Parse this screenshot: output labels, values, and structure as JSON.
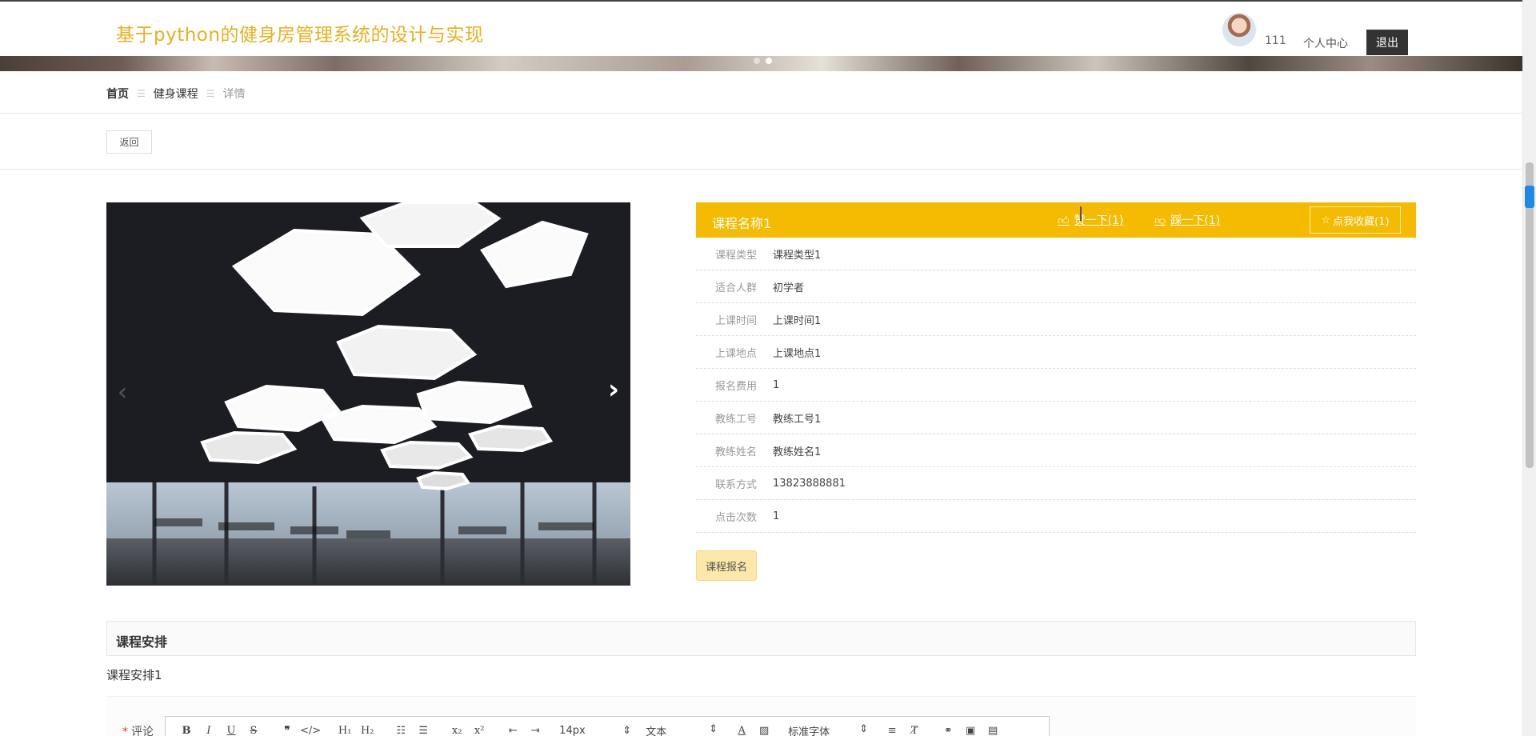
{
  "header": {
    "site_title": "基于python的健身房管理系统的设计与实现",
    "username": "111",
    "user_center": "个人中心",
    "logout": "退出"
  },
  "breadcrumb": {
    "home": "首页",
    "category": "健身课程",
    "current": "详情"
  },
  "actions": {
    "back": "返回"
  },
  "course": {
    "name": "课程名称1",
    "like_label": "赞一下(1)",
    "dislike_label": "踩一下(1)",
    "favorite_label": "点我收藏(1)",
    "fields": [
      {
        "label": "课程类型",
        "value": "课程类型1"
      },
      {
        "label": "适合人群",
        "value": "初学者"
      },
      {
        "label": "上课时间",
        "value": "上课时间1"
      },
      {
        "label": "上课地点",
        "value": "上课地点1"
      },
      {
        "label": "报名费用",
        "value": "1"
      },
      {
        "label": "教练工号",
        "value": "教练工号1"
      },
      {
        "label": "教练姓名",
        "value": "教练姓名1"
      },
      {
        "label": "联系方式",
        "value": "13823888881"
      },
      {
        "label": "点击次数",
        "value": "1"
      }
    ],
    "enroll_label": "课程报名"
  },
  "schedule": {
    "title": "课程安排",
    "content": "课程安排1"
  },
  "comment": {
    "label": "评论",
    "required_mark": "*",
    "toolbar": {
      "font_size": "14px",
      "text_type": "文本",
      "font_family": "标准字体"
    }
  },
  "colors": {
    "accent": "#f5bb00",
    "title": "#e6b020",
    "logout_bg": "#333333",
    "enroll_bg": "#fce8a8"
  }
}
